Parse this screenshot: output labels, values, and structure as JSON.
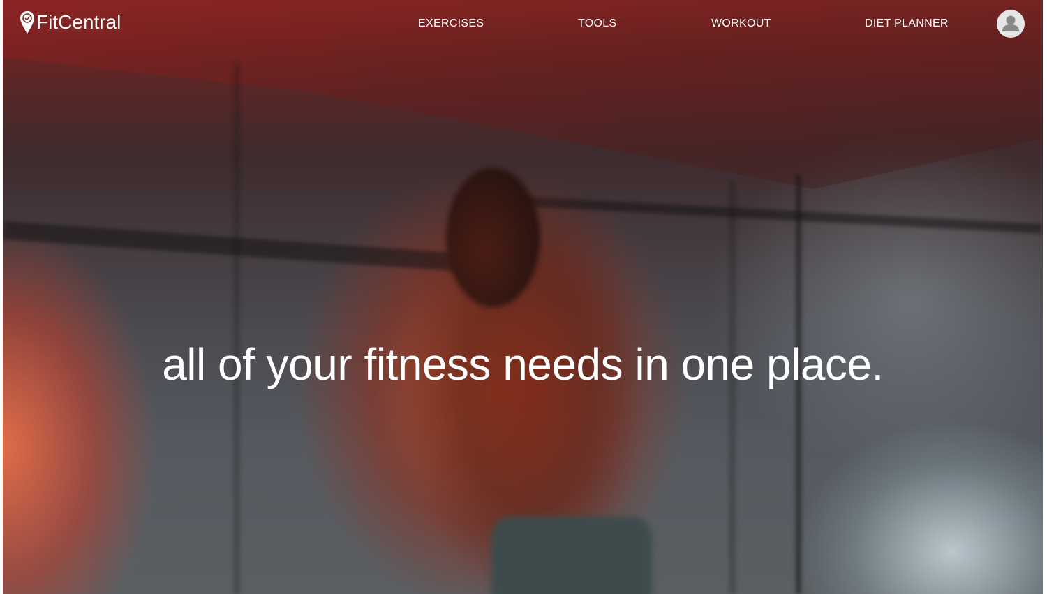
{
  "brand": {
    "name": "FitCentral",
    "icon": "map-pin-logo-icon"
  },
  "nav": {
    "items": [
      {
        "label": "EXERCISES"
      },
      {
        "label": "TOOLS"
      },
      {
        "label": "WORKOUT"
      },
      {
        "label": "DIET PLANNER"
      }
    ],
    "profile_icon": "user-avatar-icon"
  },
  "hero": {
    "tagline": "all of your fitness needs in one place.",
    "background": "blurred photo of boxer in concrete room"
  },
  "colors": {
    "text": "#ffffff",
    "accent": "#c0392b"
  }
}
